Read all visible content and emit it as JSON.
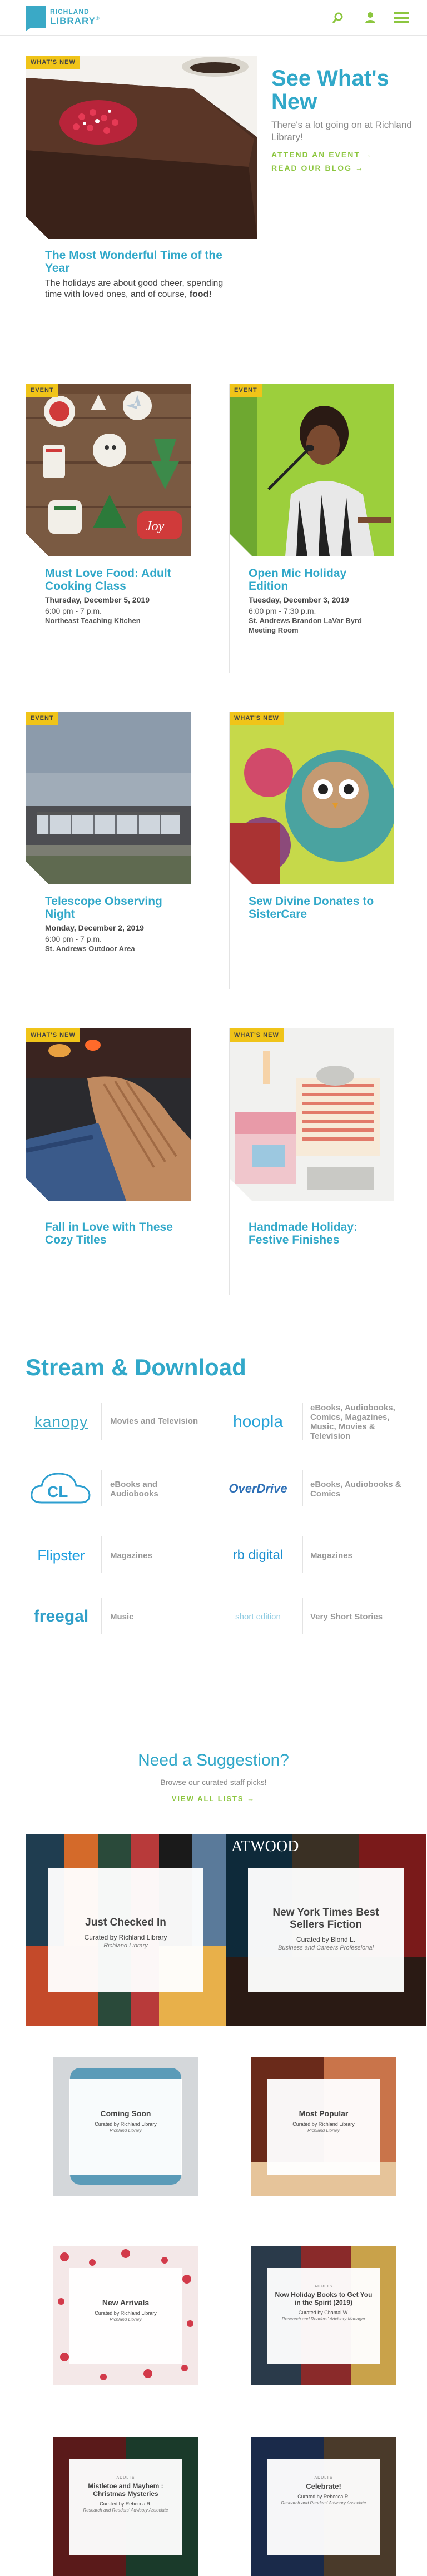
{
  "header": {
    "logo_line1": "RICHLAND",
    "logo_line2": "LIBRARY",
    "logo_tm": "®"
  },
  "colors": {
    "brand_blue": "#31a8c9",
    "accent_green": "#8cc63f",
    "badge_yellow": "#f0c419"
  },
  "hero": {
    "badge": "WHAT'S NEW",
    "title": "The Most Wonderful Time of the Year",
    "desc": "The holidays are about good cheer, spending time with loved ones, and of course,",
    "desc_bold": "food!"
  },
  "intro": {
    "heading": "See What's New",
    "text": "There's a lot going on at Richland Library!",
    "link1": "ATTEND AN EVENT →",
    "link2": "READ OUR BLOG →"
  },
  "cards": [
    {
      "badge": "EVENT",
      "title": "Must Love Food: Adult Cooking Class",
      "date": "Thursday, December 5, 2019",
      "time": "6:00 pm - 7 p.m.",
      "place": "Northeast Teaching Kitchen"
    },
    {
      "badge": "EVENT",
      "title": "Open Mic Holiday Edition",
      "date": "Tuesday, December 3, 2019",
      "time": "6:00 pm - 7:30 p.m.",
      "place": "St. Andrews Brandon LaVar Byrd Meeting Room"
    },
    {
      "badge": "EVENT",
      "title": "Telescope Observing Night",
      "date": "Monday, December 2, 2019",
      "time": "6:00 pm - 7 p.m.",
      "place": "St. Andrews Outdoor Area"
    },
    {
      "badge": "WHAT'S NEW",
      "title": "Sew Divine Donates to SisterCare"
    },
    {
      "badge": "WHAT'S NEW",
      "title": "Fall in Love with These Cozy Titles"
    },
    {
      "badge": "WHAT'S NEW",
      "title": "Handmade Holiday: Festive Finishes"
    }
  ],
  "stream": {
    "title": "Stream & Download",
    "items": [
      {
        "logo": "kanopy",
        "desc": "Movies and Television"
      },
      {
        "logo": "hoopla",
        "desc": "eBooks, Audiobooks, Comics, Magazines, Music, Movies & Television"
      },
      {
        "logo": "CL",
        "desc": "eBooks and Audiobooks"
      },
      {
        "logo": "OverDrive",
        "desc": "eBooks, Audiobooks & Comics"
      },
      {
        "logo": "Flipster",
        "desc": "Magazines"
      },
      {
        "logo": "rb digital",
        "desc": "Magazines"
      },
      {
        "logo": "freegal",
        "desc": "Music"
      },
      {
        "logo": "short edition",
        "desc": "Very Short Stories"
      }
    ]
  },
  "suggest": {
    "title": "Need a Suggestion?",
    "sub": "Browse our curated staff picks!",
    "link": "VIEW ALL LISTS →",
    "lists": [
      {
        "title": "Just Checked In",
        "by": "Curated by Richland Library",
        "role": "Richland Library"
      },
      {
        "title": "New York Times Best Sellers Fiction",
        "by": "Curated by Blond L.",
        "role": "Business and Careers Professional"
      },
      {
        "title": "Coming Soon",
        "by": "Curated by Richland Library",
        "role": "Richland Library"
      },
      {
        "title": "Most Popular",
        "by": "Curated by Richland Library",
        "role": "Richland Library"
      },
      {
        "title": "New Arrivals",
        "by": "Curated by Richland Library",
        "role": "Richland Library"
      },
      {
        "kicker": "ADULTS",
        "title": "Now Holiday Books to Get You in the Spirit (2019)",
        "by": "Curated by Chantal W.",
        "role": "Research and Readers' Advisory Manager"
      },
      {
        "kicker": "ADULTS",
        "title": "Mistletoe and Mayhem : Christmas Mysteries",
        "by": "Curated by Rebecca R.",
        "role": "Research and Readers' Advisory Associate"
      },
      {
        "kicker": "ADULTS",
        "title": "Celebrate!",
        "by": "Curated by Rebecca R.",
        "role": "Research and Readers' Advisory Associate"
      }
    ]
  }
}
